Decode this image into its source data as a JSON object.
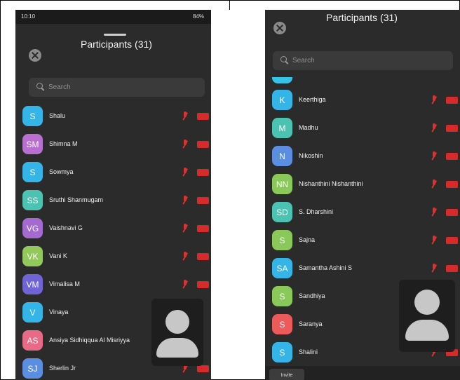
{
  "left": {
    "status_time": "10:10",
    "status_battery": "84%",
    "title": "Participants (31)",
    "search_placeholder": "Search",
    "participants": [
      {
        "initials": "S",
        "name": "Shalu",
        "color": "#35b4e8"
      },
      {
        "initials": "SM",
        "name": "Shimna M",
        "color": "#b86fd0"
      },
      {
        "initials": "S",
        "name": "Sowmya",
        "color": "#35b4e8"
      },
      {
        "initials": "SS",
        "name": "Sruthi Shanmugam",
        "color": "#4cc2b2"
      },
      {
        "initials": "VG",
        "name": "Vaishnavi G",
        "color": "#a56ad0"
      },
      {
        "initials": "VK",
        "name": "Vani K",
        "color": "#93c85a"
      },
      {
        "initials": "VM",
        "name": "Vimalisa M",
        "color": "#6f63d6"
      },
      {
        "initials": "V",
        "name": "Vinaya",
        "color": "#35b4e8"
      },
      {
        "initials": "AS",
        "name": "Ansiya Sidhiqqua Al Misriyya",
        "color": "#e86a86"
      },
      {
        "initials": "SJ",
        "name": "Sherlin Jr",
        "color": "#5b8ee0"
      }
    ]
  },
  "right": {
    "title": "Participants (31)",
    "search_placeholder": "Search",
    "participants": [
      {
        "initials": "K",
        "name": "Keerthiga",
        "color": "#35b4e8"
      },
      {
        "initials": "M",
        "name": "Madhu",
        "color": "#4cc2b2"
      },
      {
        "initials": "N",
        "name": "Nikoshin",
        "color": "#5b8ee0"
      },
      {
        "initials": "NN",
        "name": "Nishanthini Nishanthini",
        "color": "#8bc85a"
      },
      {
        "initials": "SD",
        "name": "S. Dharshini",
        "color": "#4cc2b2"
      },
      {
        "initials": "S",
        "name": "Sajna",
        "color": "#8bc85a"
      },
      {
        "initials": "SA",
        "name": "Samantha Ashini S",
        "color": "#35b4e8"
      },
      {
        "initials": "S",
        "name": "Sandhiya",
        "color": "#8bc85a"
      },
      {
        "initials": "S",
        "name": "Saranya",
        "color": "#ec5a5a"
      },
      {
        "initials": "S",
        "name": "Shalini",
        "color": "#35b4e8"
      }
    ],
    "invite_label": "Invite"
  },
  "colors": {
    "mute_red": "#e03030",
    "panel_bg": "#2b2b2b"
  }
}
